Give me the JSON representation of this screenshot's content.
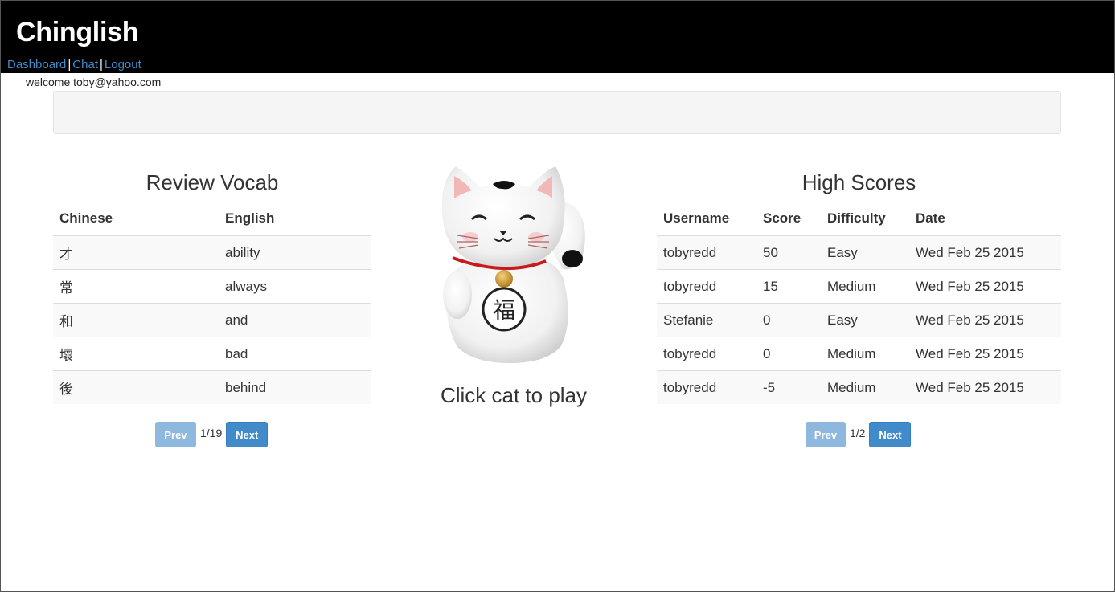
{
  "header": {
    "brand": "Chinglish",
    "nav": [
      {
        "label": "Dashboard"
      },
      {
        "label": "Chat"
      },
      {
        "label": "Logout"
      }
    ],
    "separator": "|"
  },
  "welcome": "welcome toby@yahoo.com",
  "vocab": {
    "title": "Review Vocab",
    "columns": [
      "Chinese",
      "English"
    ],
    "rows": [
      [
        "才",
        "ability"
      ],
      [
        "常",
        "always"
      ],
      [
        "和",
        "and"
      ],
      [
        "壞",
        "bad"
      ],
      [
        "後",
        "behind"
      ]
    ],
    "pager": {
      "prev": "Prev",
      "page": "1/19",
      "next": "Next"
    }
  },
  "cat": {
    "label": "Click cat to play",
    "emblem": "福"
  },
  "scores": {
    "title": "High Scores",
    "columns": [
      "Username",
      "Score",
      "Difficulty",
      "Date"
    ],
    "rows": [
      [
        "tobyredd",
        "50",
        "Easy",
        "Wed Feb 25 2015"
      ],
      [
        "tobyredd",
        "15",
        "Medium",
        "Wed Feb 25 2015"
      ],
      [
        "Stefanie",
        "0",
        "Easy",
        "Wed Feb 25 2015"
      ],
      [
        "tobyredd",
        "0",
        "Medium",
        "Wed Feb 25 2015"
      ],
      [
        "tobyredd",
        "-5",
        "Medium",
        "Wed Feb 25 2015"
      ]
    ],
    "pager": {
      "prev": "Prev",
      "page": "1/2",
      "next": "Next"
    }
  },
  "colors": {
    "header_bg": "#000000",
    "link": "#428bca",
    "button": "#428bca",
    "button_disabled": "#8fb8df"
  }
}
